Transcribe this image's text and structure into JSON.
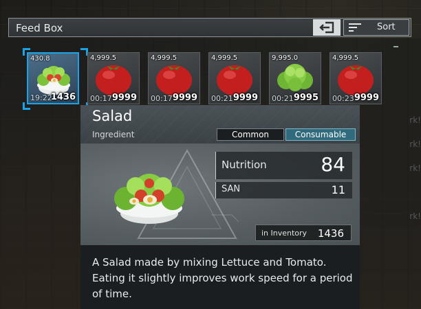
{
  "header": {
    "title": "Feed Box",
    "sort_label": "Sort"
  },
  "slots": [
    {
      "weight": "430.8",
      "time": "19:22",
      "qty": "1436",
      "item": "salad",
      "selected": true
    },
    {
      "weight": "4,999.5",
      "time": "00:17",
      "qty": "9999",
      "item": "tomato"
    },
    {
      "weight": "4,999.5",
      "time": "00:17",
      "qty": "9999",
      "item": "tomato"
    },
    {
      "weight": "4,999.5",
      "time": "00:21",
      "qty": "9999",
      "item": "tomato"
    },
    {
      "weight": "9,995.0",
      "time": "00:21",
      "qty": "9995",
      "item": "lettuce"
    },
    {
      "weight": "4,999.5",
      "time": "00:23",
      "qty": "9999",
      "item": "tomato"
    }
  ],
  "tooltip": {
    "name": "Salad",
    "type": "Ingredient",
    "rarity": "Common",
    "tag": "Consumable",
    "nutrition_label": "Nutrition",
    "nutrition_value": "84",
    "san_label": "SAN",
    "san_value": "11",
    "inventory_label": "in Inventory",
    "inventory_value": "1436",
    "description": "A Salad made by mixing Lettuce and Tomato. Eating it slightly improves work speed for a period of time."
  },
  "colors": {
    "selection": "#1aa3e8",
    "consumable_tag": "#2f6b7c",
    "panel_dark": "#1b1e20"
  }
}
